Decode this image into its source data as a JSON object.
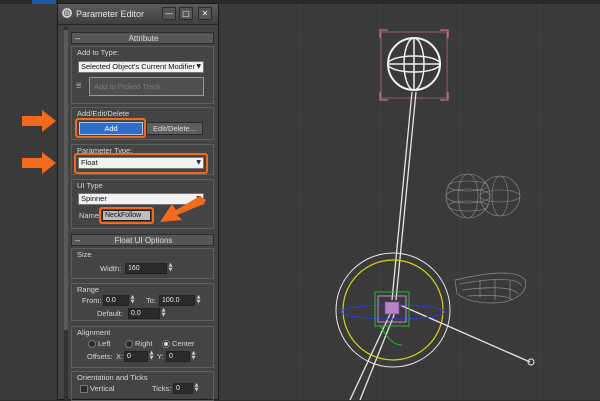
{
  "window": {
    "title": "Parameter Editor",
    "buttons": {
      "minimize": "—",
      "maximize": "□",
      "close": "✕"
    }
  },
  "attribute_rollout": {
    "title": "Attribute",
    "add_to_type": {
      "label": "Add to Type:",
      "selected": "Selected Object's Current Modifier",
      "pick_button": "Add to Picked Track"
    },
    "add_edit_delete": {
      "label": "Add/Edit/Delete",
      "add_button": "Add",
      "edit_delete_button": "Edit/Delete..."
    },
    "parameter_type": {
      "label": "Parameter Type:",
      "selected": "Float"
    },
    "ui_type": {
      "label": "UI Type",
      "selected": "Spinner",
      "name_label": "Name:",
      "name_value": "NeckFollow"
    }
  },
  "float_ui_rollout": {
    "title": "Float UI Options",
    "size": {
      "label": "Size",
      "width_label": "Width:",
      "width_value": "160"
    },
    "range": {
      "label": "Range",
      "from_label": "From:",
      "from_value": "0.0",
      "to_label": "To:",
      "to_value": "100.0",
      "default_label": "Default:",
      "default_value": "0.0"
    },
    "alignment": {
      "label": "Alignment",
      "left": "Left",
      "right": "Right",
      "center": "Center",
      "selected": "Center",
      "offsets_label": "Offsets:",
      "x_label": "X:",
      "x_value": "0",
      "y_label": "Y:",
      "y_value": "0"
    },
    "orientation": {
      "label": "Orientation and Ticks",
      "vertical_label": "Vertical",
      "ticks_label": "Ticks:",
      "ticks_value": "0"
    }
  },
  "colors": {
    "accent": "#2e6fc9",
    "highlight": "#f26a1b",
    "panel": "#444444",
    "viewport": "#3a3a3a"
  },
  "icons": [
    "app-icon",
    "pick-track-icon",
    "dropdown-arrow-icon",
    "spinner-arrows-icon",
    "annotation-arrow-icon"
  ]
}
